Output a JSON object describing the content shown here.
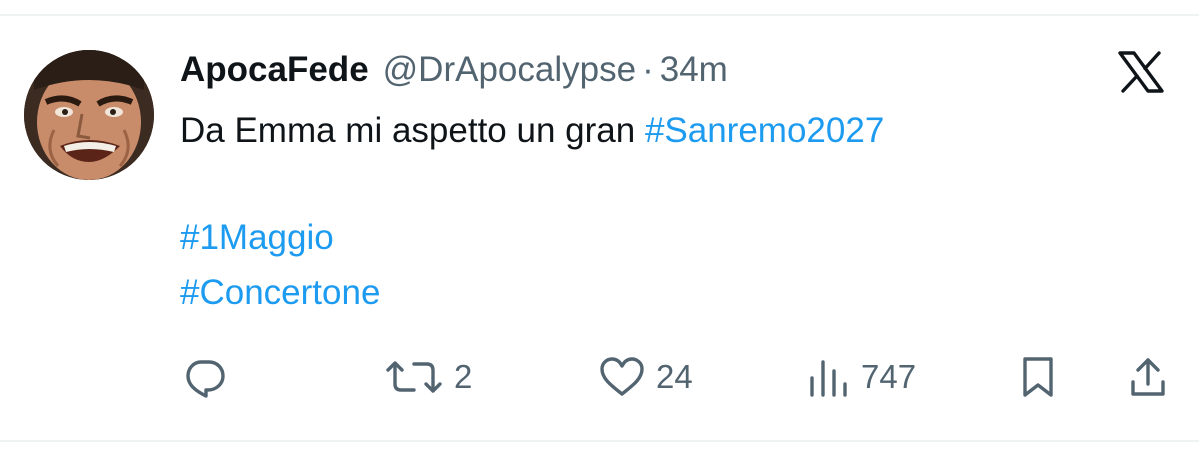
{
  "tweet": {
    "author": {
      "display_name": "ApocaFede",
      "handle": "@DrApocalypse",
      "separator": "·",
      "time": "34m"
    },
    "text_prefix": "Da Emma mi aspetto un gran ",
    "hashtags": [
      "#Sanremo2027",
      "#1Maggio",
      "#Concertone"
    ],
    "actions": {
      "reply_icon": "reply-icon",
      "retweet_icon": "retweet-icon",
      "retweet_count": "2",
      "like_icon": "heart-icon",
      "like_count": "24",
      "views_icon": "bar-chart-icon",
      "views_count": "747",
      "bookmark_icon": "bookmark-icon",
      "share_icon": "share-icon"
    }
  },
  "brand": {
    "logo": "x-logo-icon"
  },
  "colors": {
    "hashtag": "#1d9bf0",
    "secondary_text": "#536471",
    "primary_text": "#0f1419",
    "divider": "#eff3f4"
  }
}
